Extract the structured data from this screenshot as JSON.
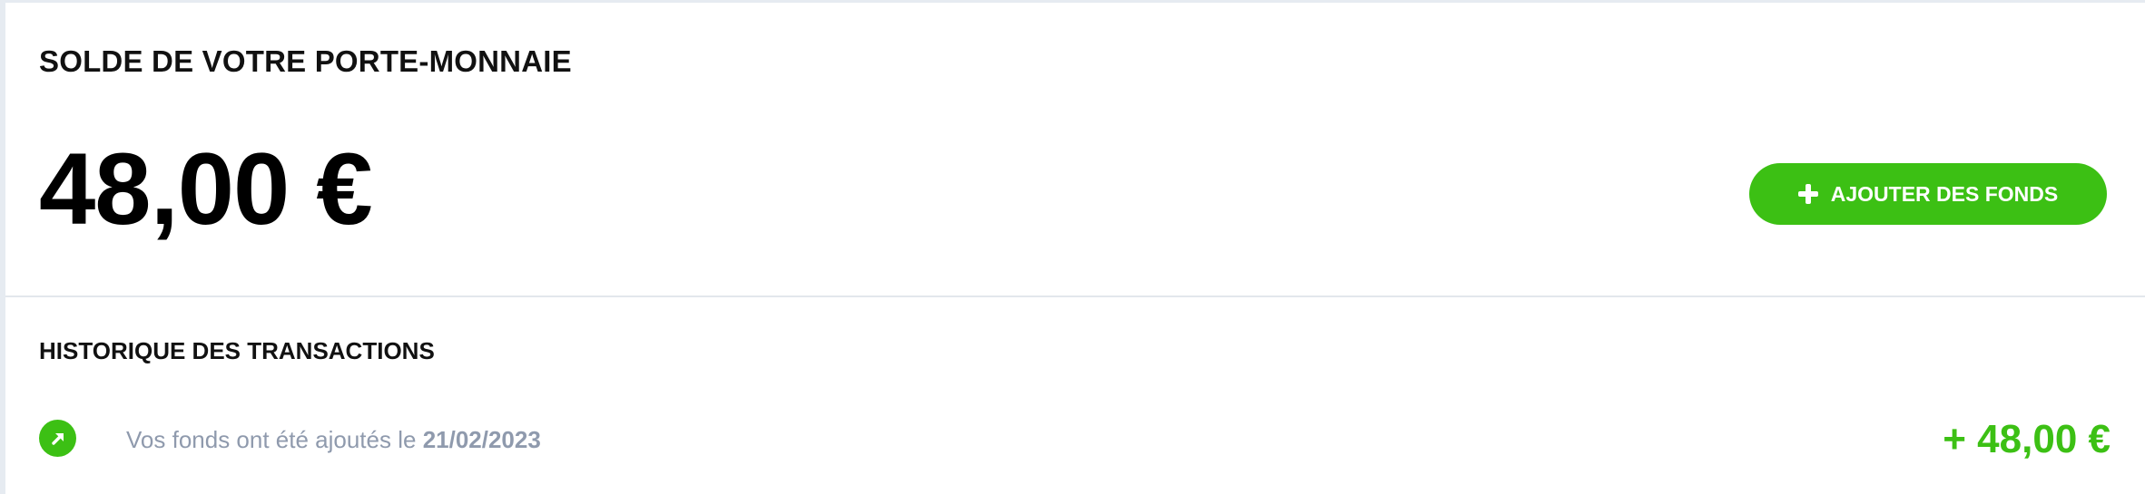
{
  "wallet": {
    "title": "SOLDE DE VOTRE PORTE-MONNAIE",
    "balance": "48,00 €",
    "add_funds_label": "AJOUTER DES FONDS"
  },
  "history": {
    "title": "HISTORIQUE DES TRANSACTIONS",
    "transactions": [
      {
        "text": "Vos fonds ont été ajoutés le ",
        "date": "21/02/2023",
        "amount": "+ 48,00 €",
        "icon": "arrow-up-right-icon"
      }
    ]
  },
  "colors": {
    "accent": "#3cc014",
    "muted_text": "#8f9aad",
    "background": "#e6ebf1"
  }
}
